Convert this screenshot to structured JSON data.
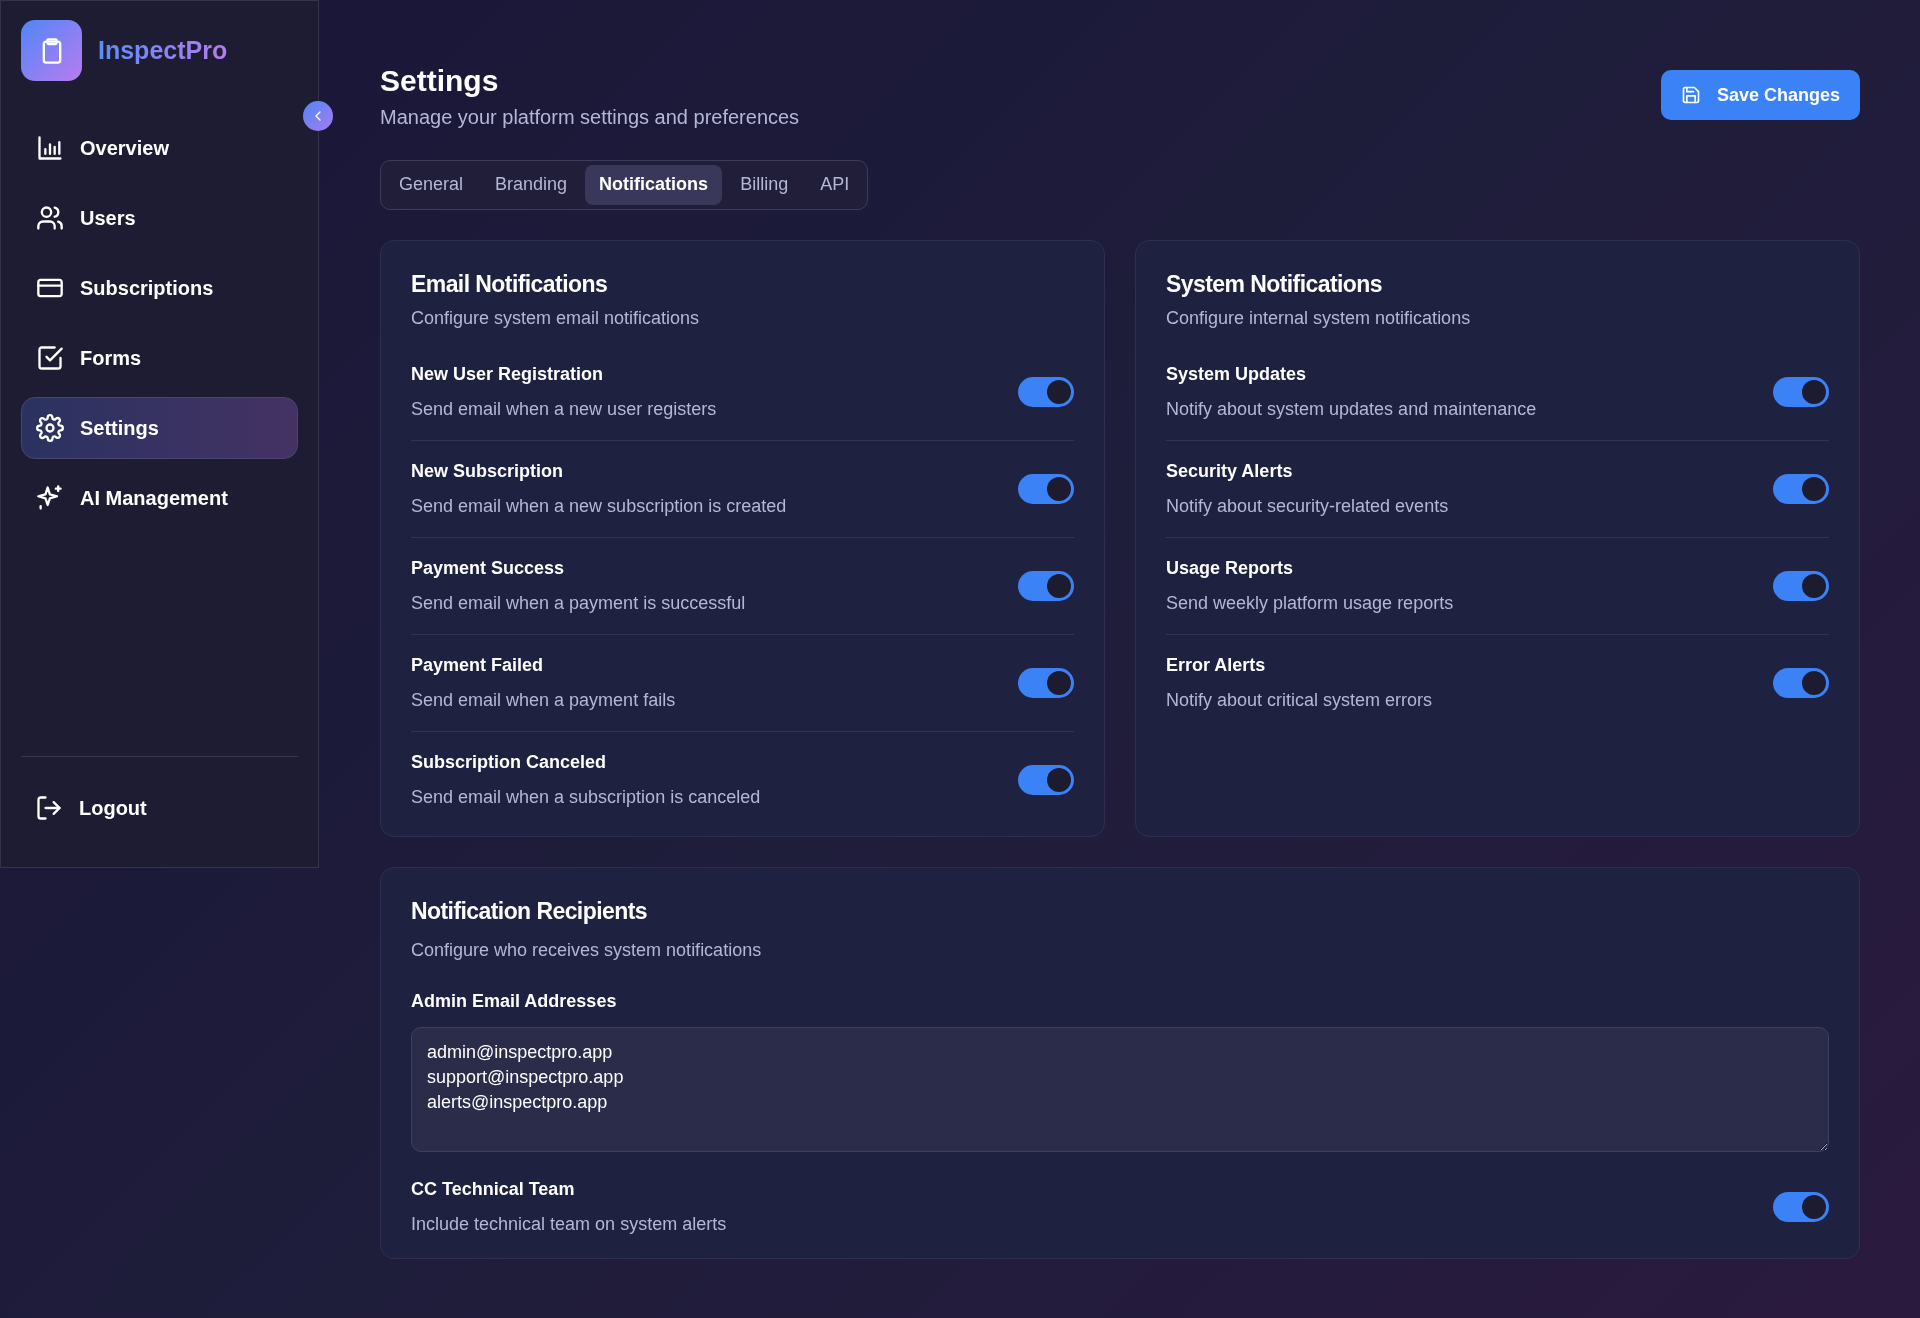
{
  "brand": {
    "name": "InspectPro"
  },
  "sidebar": {
    "items": [
      {
        "label": "Overview",
        "selected": false
      },
      {
        "label": "Users",
        "selected": false
      },
      {
        "label": "Subscriptions",
        "selected": false
      },
      {
        "label": "Forms",
        "selected": false
      },
      {
        "label": "Settings",
        "selected": true
      },
      {
        "label": "AI Management",
        "selected": false
      }
    ],
    "logout": "Logout"
  },
  "header": {
    "title": "Settings",
    "subtitle": "Manage your platform settings and preferences",
    "save_button": "Save Changes"
  },
  "tabs": [
    {
      "label": "General",
      "selected": false
    },
    {
      "label": "Branding",
      "selected": false
    },
    {
      "label": "Notifications",
      "selected": true
    },
    {
      "label": "Billing",
      "selected": false
    },
    {
      "label": "API",
      "selected": false
    }
  ],
  "email_notifications": {
    "title": "Email Notifications",
    "subtitle": "Configure system email notifications",
    "items": [
      {
        "label": "New User Registration",
        "description": "Send email when a new user registers",
        "on": true
      },
      {
        "label": "New Subscription",
        "description": "Send email when a new subscription is created",
        "on": true
      },
      {
        "label": "Payment Success",
        "description": "Send email when a payment is successful",
        "on": true
      },
      {
        "label": "Payment Failed",
        "description": "Send email when a payment fails",
        "on": true
      },
      {
        "label": "Subscription Canceled",
        "description": "Send email when a subscription is canceled",
        "on": true
      }
    ]
  },
  "system_notifications": {
    "title": "System Notifications",
    "subtitle": "Configure internal system notifications",
    "items": [
      {
        "label": "System Updates",
        "description": "Notify about system updates and maintenance",
        "on": true
      },
      {
        "label": "Security Alerts",
        "description": "Notify about security-related events",
        "on": true
      },
      {
        "label": "Usage Reports",
        "description": "Send weekly platform usage reports",
        "on": true
      },
      {
        "label": "Error Alerts",
        "description": "Notify about critical system errors",
        "on": true
      }
    ]
  },
  "recipients": {
    "title": "Notification Recipients",
    "subtitle": "Configure who receives system notifications",
    "field_label": "Admin Email Addresses",
    "field_value": "admin@inspectpro.app\nsupport@inspectpro.app\nalerts@inspectpro.app",
    "cc": {
      "label": "CC Technical Team",
      "description": "Include technical team on system alerts",
      "on": true
    }
  }
}
